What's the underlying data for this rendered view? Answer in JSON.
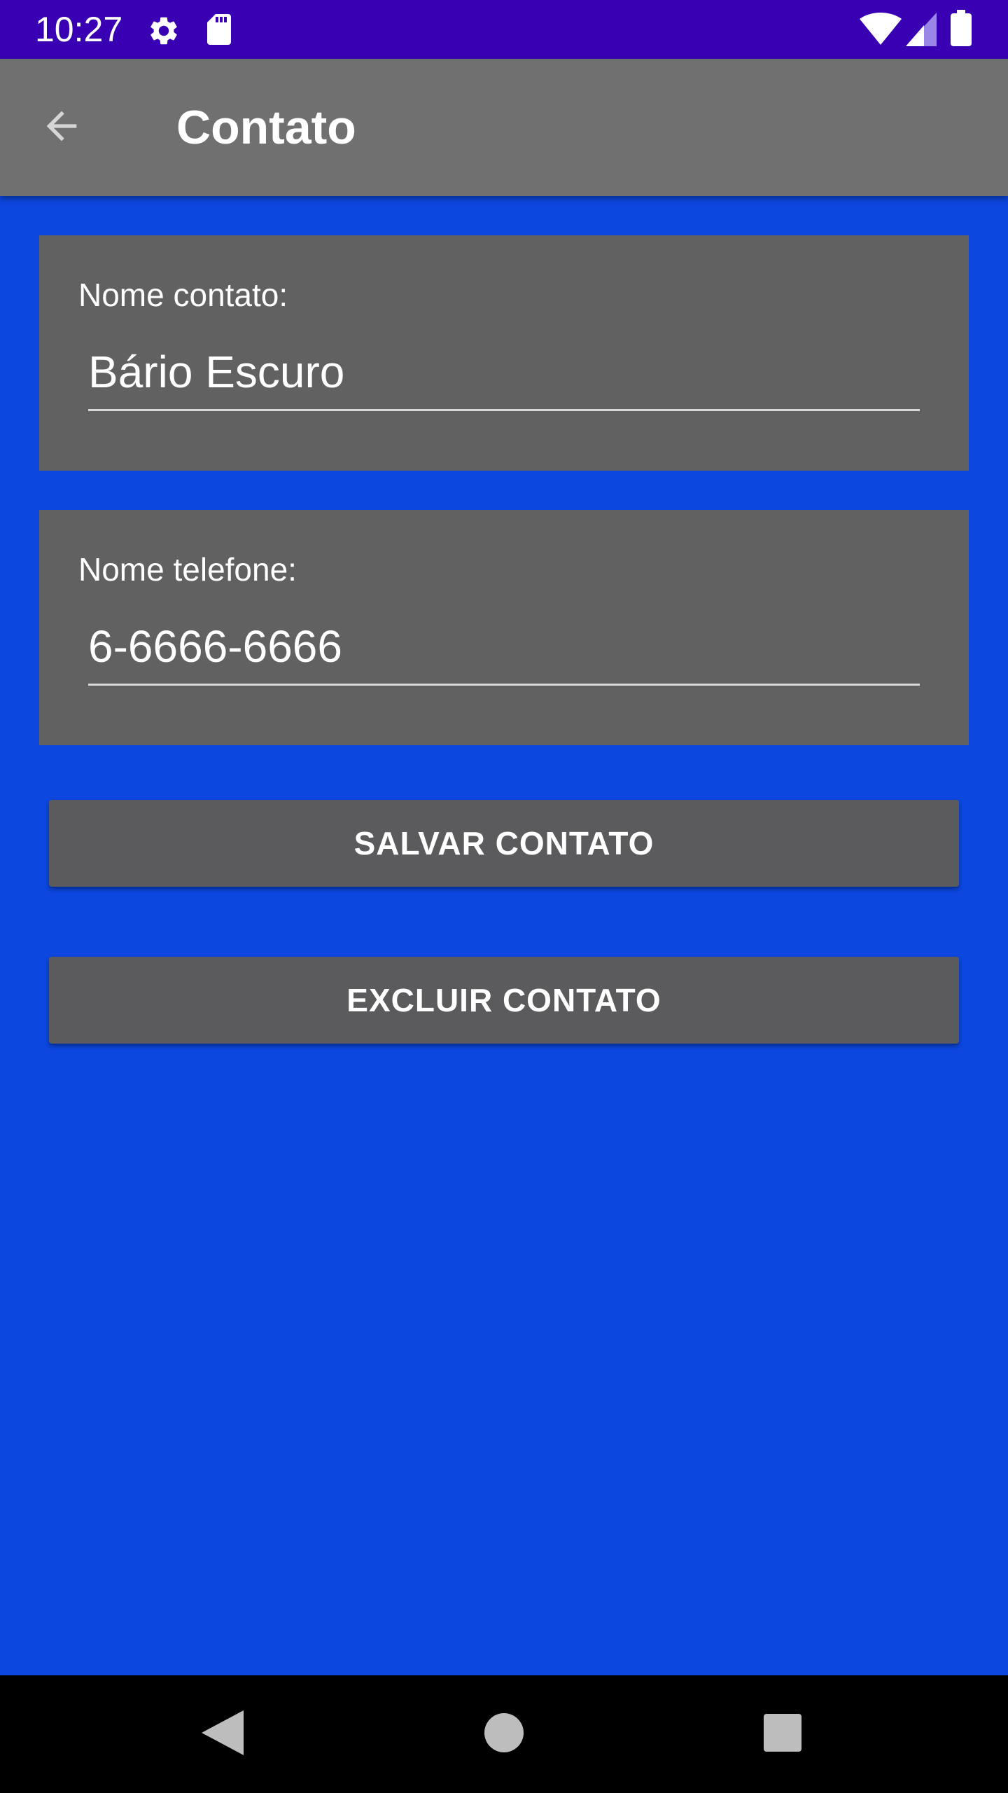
{
  "status_bar": {
    "time": "10:27",
    "icons": [
      "gear-icon",
      "sd-card-icon",
      "wifi-icon",
      "signal-icon",
      "battery-icon"
    ]
  },
  "app_bar": {
    "title": "Contato",
    "back_icon": "arrow-back-icon"
  },
  "form": {
    "contact_name": {
      "label": "Nome contato:",
      "value": "Bário Escuro"
    },
    "phone": {
      "label": "Nome telefone:",
      "value": "6-6666-6666"
    }
  },
  "actions": {
    "save_label": "SALVAR CONTATO",
    "delete_label": "EXCLUIR CONTATO"
  },
  "nav_bar": {
    "icons": [
      "back-triangle-icon",
      "home-circle-icon",
      "recents-square-icon"
    ]
  },
  "colors": {
    "status_bar": "#3800b2",
    "app_bar": "#707070",
    "background": "#0c47df",
    "card": "#616161",
    "button": "#5b5b5d"
  }
}
